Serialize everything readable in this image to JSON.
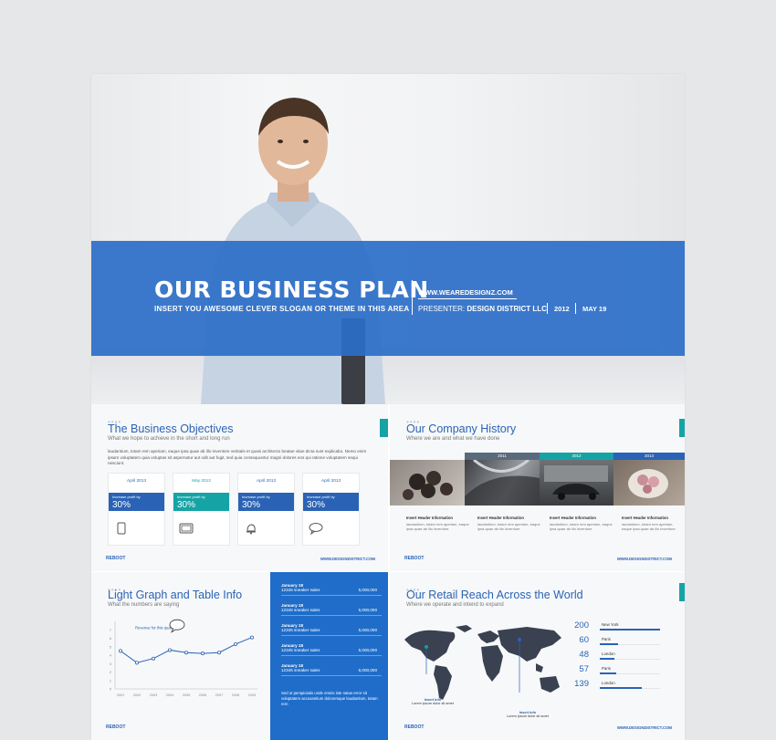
{
  "hero": {
    "title": "OUR BUSINESS PLAN",
    "slogan": "INSERT YOU AWESOME CLEVER SLOGAN OR THEME IN THIS AREA",
    "url": "WWW.WEAREDESIGNZ.COM",
    "presenter_label": "PRESENTER: ",
    "presenter_name": "DESIGN DISTRICT LLC",
    "year": "2012",
    "date": "MAY 19"
  },
  "colors": {
    "brand_blue": "#2b6ec8",
    "teal": "#16a3a5",
    "dark_blue": "#1f6dc9"
  },
  "objectives": {
    "title": "The Business Objectives",
    "subtitle": "What we hope to achieve in the short and long run",
    "paragraph": "laudantium, totam rem aperiam, eaque ipsa quae ab illo inventore veritatis et quasi architecto beatae vitae dicta sunt explicabo. Nemo enim ipsam voluptatem quia voluptas sit aspernatur aut odit aut fugit, sed quia consequuntur magni dolores eos qui ratione voluptatem sequi nesciunt.",
    "cards": [
      {
        "date": "April 2013",
        "label": "Increase profit by",
        "value": "30%",
        "icon": "phone-icon"
      },
      {
        "date": "May 2013",
        "label": "Increase profit by",
        "value": "30%",
        "icon": "tv-icon"
      },
      {
        "date": "April 2013",
        "label": "Increase profit by",
        "value": "30%",
        "icon": "bell-icon"
      },
      {
        "date": "April 2013",
        "label": "Increase profit by",
        "value": "30%",
        "icon": "speech-bubble-icon"
      }
    ],
    "footer_left": "REBOOT",
    "footer_right": "WWW.DESIGNDISTRICT.COM"
  },
  "history": {
    "title": "Our Company History",
    "subtitle": "Where we are and what we have done",
    "years": [
      "2011",
      "2012",
      "2013"
    ],
    "items": [
      {
        "header": "Insert Header Information",
        "text": "laudantium, totam rem aperiam, eaque ipsa quae ab illo inventore"
      },
      {
        "header": "Insert Header Information",
        "text": "laudantium, totam rem aperiam, eaque ipsa quae ab illo inventore"
      },
      {
        "header": "Insert Header Information",
        "text": "laudantium, totam rem aperiam, eaque ipsa quae ab illo inventore"
      },
      {
        "header": "Insert Header Information",
        "text": "laudantium, totam rem aperiam, eaque ipsa quae ab illo inventore"
      }
    ],
    "footer_left": "REBOOT",
    "footer_right": "WWW.DESIGNDISTRICT.COM"
  },
  "graph": {
    "title": "Light Graph and Table Info",
    "subtitle": "What the numbers are saying",
    "callout": "Revenue for this quarter",
    "footer_left": "REBOOT"
  },
  "chart_data": {
    "type": "line",
    "x": [
      "2001",
      "2002",
      "2003",
      "2004",
      "2005",
      "2006",
      "2007",
      "2008",
      "2009"
    ],
    "series": [
      {
        "values": [
          4.5,
          3.1,
          3.6,
          4.6,
          4.3,
          4.2,
          4.3,
          5.3,
          6.1
        ]
      }
    ],
    "yticks": [
      "0",
      "1",
      "2",
      "3",
      "4",
      "5",
      "6",
      "7"
    ],
    "ylim": [
      0,
      8
    ],
    "title": "",
    "xlabel": "",
    "ylabel": "",
    "grid": false
  },
  "sales": {
    "rows": [
      {
        "date": "January 18",
        "desc": "12345 sneaker sales",
        "value": "5,000,000"
      },
      {
        "date": "January 18",
        "desc": "12345 sneaker sales",
        "value": "5,000,000"
      },
      {
        "date": "January 18",
        "desc": "12345 sneaker sales",
        "value": "5,000,000"
      },
      {
        "date": "January 18",
        "desc": "12345 sneaker sales",
        "value": "5,000,000"
      },
      {
        "date": "January 18",
        "desc": "12345 sneaker sales",
        "value": "5,000,000"
      }
    ],
    "note": "Sed ut perspiciatis unde omnis iste natus error sit voluptatem accusantium doloremque laudantium, totam rem"
  },
  "retail": {
    "title": "Our Retail Reach Across the World",
    "subtitle": "Where we operate and intend to expand",
    "locations": [
      {
        "value": "200",
        "name": "New York",
        "fill": 1.0
      },
      {
        "value": "60",
        "name": "Paris",
        "fill": 0.3
      },
      {
        "value": "48",
        "name": "London",
        "fill": 0.24
      },
      {
        "value": "57",
        "name": "Paris",
        "fill": 0.28
      },
      {
        "value": "139",
        "name": "London",
        "fill": 0.7
      }
    ],
    "map_labels": [
      {
        "title": "Insert Info",
        "text": "Lorem ipsum dolor sit amet"
      },
      {
        "title": "Insert Info",
        "text": "Lorem ipsum dolor sit amet"
      }
    ],
    "footer_left": "REBOOT",
    "footer_right": "WWW.DESIGNDISTRICT.COM"
  }
}
